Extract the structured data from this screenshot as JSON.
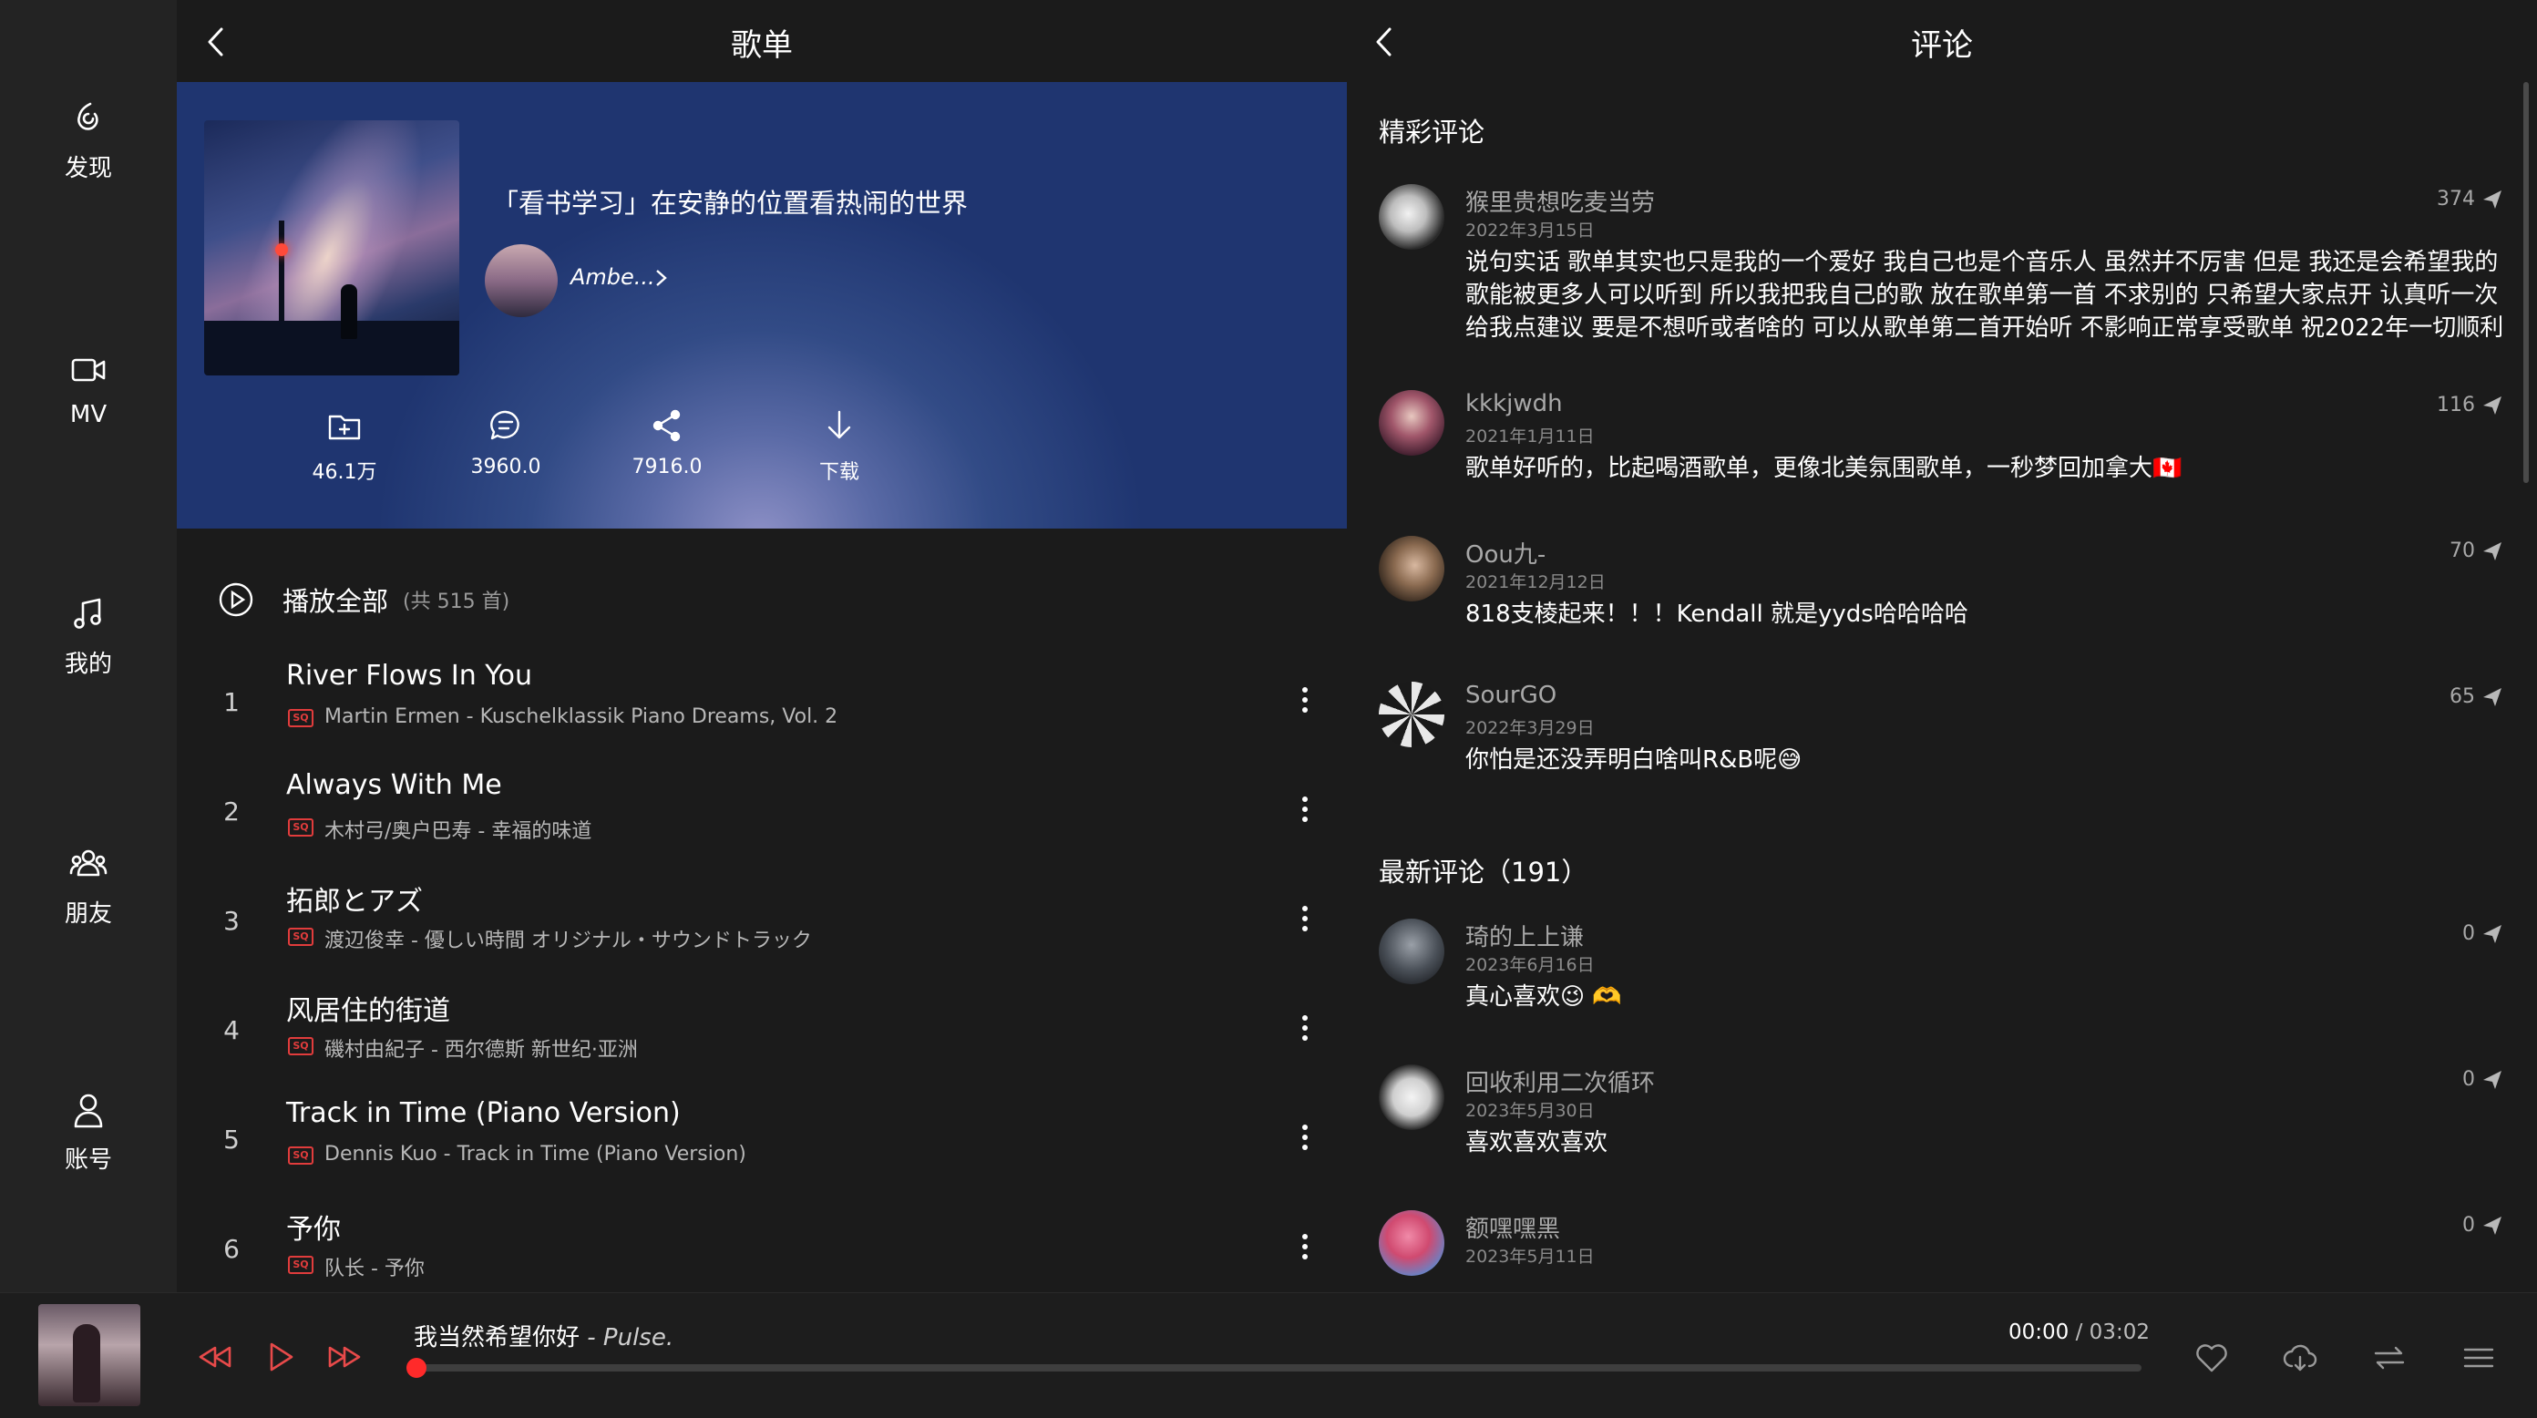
{
  "nav": {
    "items": [
      {
        "label": "发现",
        "icon": "discover-icon"
      },
      {
        "label": "MV",
        "icon": "video-icon"
      },
      {
        "label": "我的",
        "icon": "music-note-icon"
      },
      {
        "label": "朋友",
        "icon": "friends-icon"
      },
      {
        "label": "账号",
        "icon": "account-icon"
      }
    ]
  },
  "playlist": {
    "header_title": "歌单",
    "name": "「看书学习」在安静的位置看热闹的世界",
    "creator": "Ambe...",
    "stats": {
      "collect": "46.1万",
      "comments": "3960.0",
      "share": "7916.0",
      "download": "下载"
    },
    "play_all": "播放全部",
    "count": "(共 515 首)",
    "quality_badge": "SQ",
    "songs": [
      {
        "index": "1",
        "title": "River Flows In You",
        "subtitle": "Martin Ermen - Kuschelklassik Piano Dreams, Vol. 2"
      },
      {
        "index": "2",
        "title": "Always With Me",
        "subtitle": "木村弓/奥户巴寿 - 幸福的味道"
      },
      {
        "index": "3",
        "title": "拓郎とアズ",
        "subtitle": "渡辺俊幸 - 優しい時間 オリジナル・サウンドトラック"
      },
      {
        "index": "4",
        "title": "风居住的街道",
        "subtitle": "磯村由紀子 - 西尔德斯 新世纪·亚洲"
      },
      {
        "index": "5",
        "title": "Track in Time (Piano Version)",
        "subtitle": "Dennis Kuo - Track in Time (Piano Version)"
      },
      {
        "index": "6",
        "title": "予你",
        "subtitle": "队长 - 予你"
      }
    ]
  },
  "comments": {
    "header_title": "评论",
    "hot_title": "精彩评论",
    "latest_title": "最新评论（191）",
    "hot": [
      {
        "user": "猴里贵想吃麦当劳",
        "date": "2022年3月15日",
        "likes": "374",
        "text": "说句实话 歌单其实也只是我的一个爱好 我自己也是个音乐人 虽然并不厉害 但是 我还是会希望我的歌能被更多人可以听到 所以我把我自己的歌 放在歌单第一首 不求别的 只希望大家点开 认真听一次 给我点建议 要是不想听或者啥的 可以从歌单第二首开始听 不影响正常享受歌单 祝2022年一切顺利"
      },
      {
        "user": "kkkjwdh",
        "date": "2021年1月11日",
        "likes": "116",
        "text": "歌单好听的，比起喝酒歌单，更像北美氛围歌单，一秒梦回加拿大🇨🇦"
      },
      {
        "user": "Oou九-",
        "date": "2021年12月12日",
        "likes": "70",
        "text": "818支棱起来！！！Kendall 就是yyds哈哈哈哈"
      },
      {
        "user": "SourGO",
        "date": "2022年3月29日",
        "likes": "65",
        "text": "你怕是还没弄明白啥叫R&B呢😅"
      }
    ],
    "latest": [
      {
        "user": "琦的上上谦",
        "date": "2023年6月16日",
        "likes": "0",
        "text": "真心喜欢😉 🫶"
      },
      {
        "user": "回收利用二次循环",
        "date": "2023年5月30日",
        "likes": "0",
        "text": "喜欢喜欢喜欢"
      },
      {
        "user": "额嘿嘿黑",
        "date": "2023年5月11日",
        "likes": "0",
        "text": ""
      }
    ]
  },
  "player": {
    "song": "我当然希望你好",
    "artist": "- Pulse.",
    "current": "00:00",
    "separator": " / ",
    "total": "03:02",
    "progress": 0.0,
    "accent": "#e83a3a"
  }
}
